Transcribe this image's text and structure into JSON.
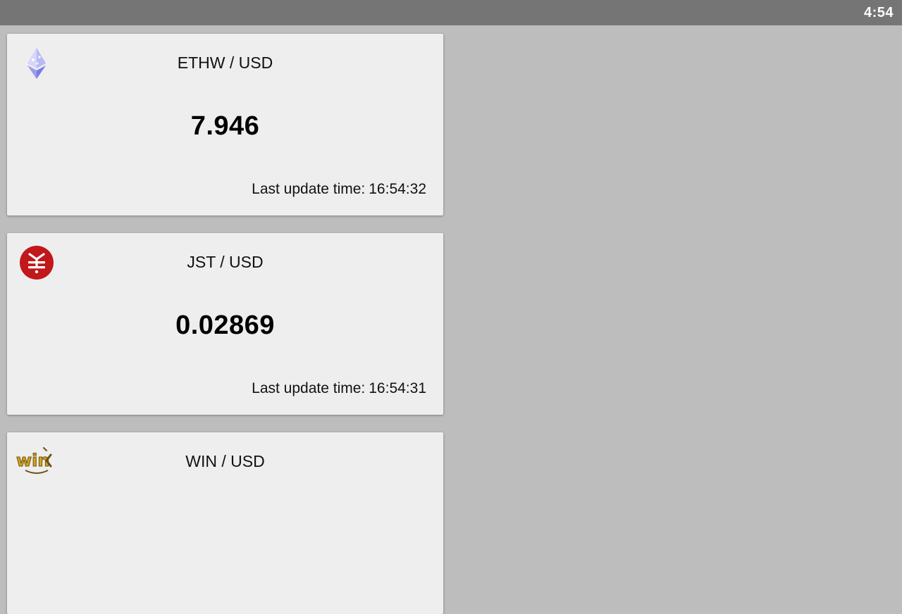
{
  "status_bar": {
    "clock": "4:54"
  },
  "update_label": "Last update time:",
  "cards": [
    {
      "pair": "ETHW / USD",
      "price": "7.946",
      "updated": "16:54:32",
      "icon": "ethereum-pow-icon"
    },
    {
      "pair": "JST / USD",
      "price": "0.02869",
      "updated": "16:54:31",
      "icon": "just-icon",
      "accent": "#c0181b"
    },
    {
      "pair": "WIN / USD",
      "price": "",
      "updated": "",
      "icon": "wink-icon",
      "accent": "#d2a21e"
    }
  ]
}
